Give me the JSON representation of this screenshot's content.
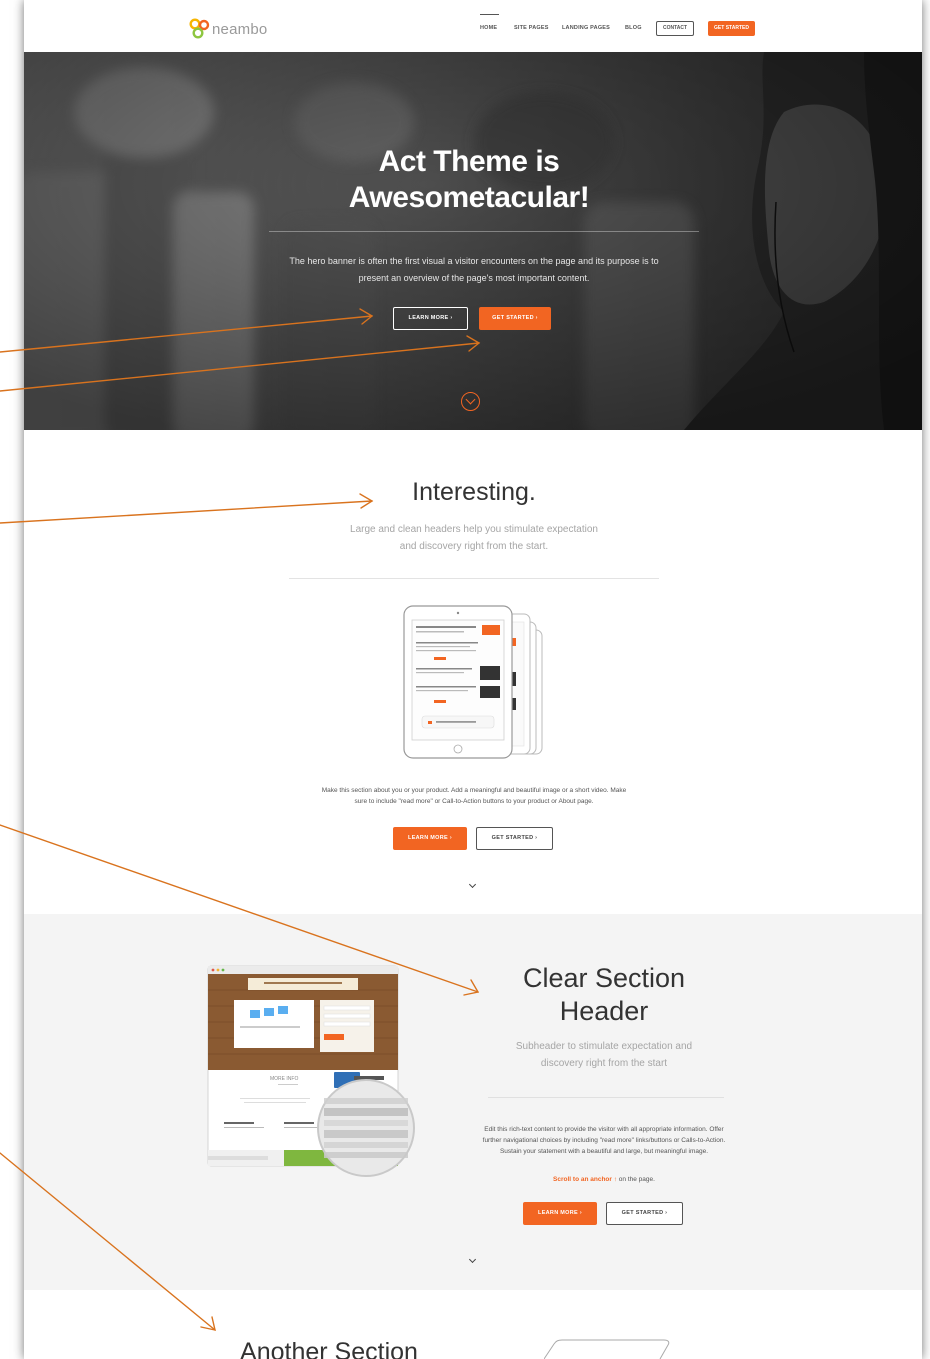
{
  "nav": {
    "logo_text": "neambo",
    "links": [
      "HOME",
      "SITE PAGES",
      "LANDING PAGES",
      "BLOG"
    ],
    "contact_label": "CONTACT",
    "get_started_label": "GET STARTED"
  },
  "hero": {
    "title_line1": "Act Theme is",
    "title_line2": "Awesometacular!",
    "text_line1": "The hero banner is often the first visual a visitor encounters on the page and its purpose is to",
    "text_line2": "present an overview of the page's most important content.",
    "learn_more_label": "LEARN MORE ›",
    "get_started_label": "GET STARTED ›"
  },
  "section_interesting": {
    "title": "Interesting.",
    "subtitle_line1": "Large and clean headers help you stimulate expectation",
    "subtitle_line2": "and discovery right from the start.",
    "body_line1": "Make this section about you or your product. Add a meaningful and beautiful image or a short video. Make",
    "body_line2": "sure to include \"read more\" or Call-to-Action buttons to your product or About page.",
    "learn_more_label": "LEARN MORE ›",
    "get_started_label": "GET STARTED ›"
  },
  "section_clear": {
    "title_line1": "Clear Section",
    "title_line2": "Header",
    "subtitle_line1": "Subheader to stimulate expectation and",
    "subtitle_line2": "discovery right from the start",
    "body_line1": "Edit this rich-text content to provide the visitor with all appropriate information. Offer",
    "body_line2": "further navigational choices by including \"read more\" links/buttons or Calls-to-Action.",
    "body_line3": "Sustain your statement with a beautiful and large, but meaningful image.",
    "anchor_link": "Scroll to an anchor ↑",
    "anchor_suffix": " on the page.",
    "screenshot_more_info": "MORE INFO",
    "learn_more_label": "LEARN MORE ›",
    "get_started_label": "GET STARTED ›"
  },
  "section_another": {
    "title": "Another Section"
  },
  "colors": {
    "accent": "#f26522",
    "annotation_arrow": "#d9731e",
    "section_alt_bg": "#f4f4f4"
  }
}
